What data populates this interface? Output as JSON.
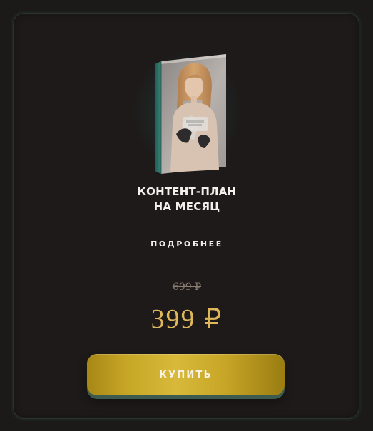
{
  "product": {
    "title_line_1": "КОНТЕНТ-ПЛАН",
    "title_line_2": "НА МЕСЯЦ",
    "details_label": "ПОДРОБНЕЕ",
    "old_price": "699 ₽",
    "price": "399 ₽",
    "buy_label": "КУПИТЬ"
  },
  "colors": {
    "background": "#1c1919",
    "card_border": "#2b3432",
    "title": "#f3f0ec",
    "price_gold": "#ddb75a",
    "button_gold": "#c7a626",
    "book_spine": "#2d7268"
  }
}
